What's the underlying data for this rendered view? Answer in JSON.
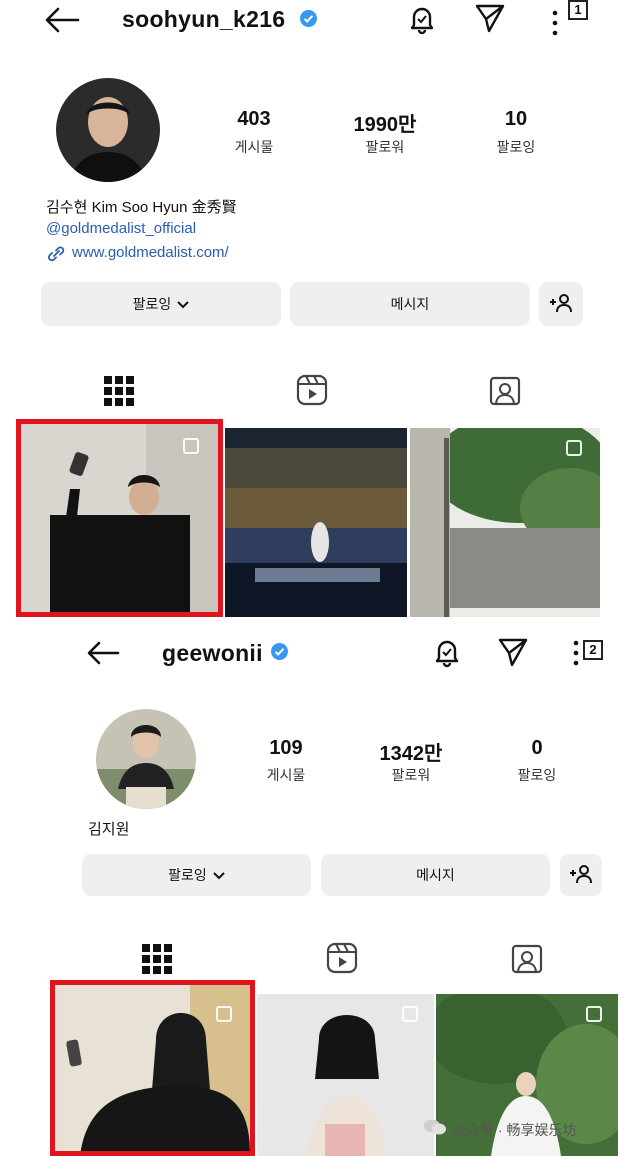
{
  "profile1": {
    "username": "soohyun_k216",
    "badge": "1",
    "stats": [
      {
        "value": "403",
        "label": "게시물"
      },
      {
        "value": "1990만",
        "label": "팔로워"
      },
      {
        "value": "10",
        "label": "팔로잉"
      }
    ],
    "bio_name": "김수현 Kim Soo Hyun 金秀賢",
    "mention": "@goldmedalist_official",
    "website": "www.goldmedalist.com/",
    "follow_label": "팔로잉",
    "message_label": "메시지"
  },
  "profile2": {
    "username": "geewonii",
    "badge": "2",
    "stats": [
      {
        "value": "109",
        "label": "게시물"
      },
      {
        "value": "1342만",
        "label": "팔로워"
      },
      {
        "value": "0",
        "label": "팔로잉"
      }
    ],
    "bio_name": "김지원",
    "follow_label": "팔로잉",
    "message_label": "메시지"
  },
  "watermark": "公众号 · 畅享娱乐坊",
  "colors": {
    "verified": "#3897f0",
    "highlight": "#e0141e",
    "link": "#2a5db0"
  }
}
